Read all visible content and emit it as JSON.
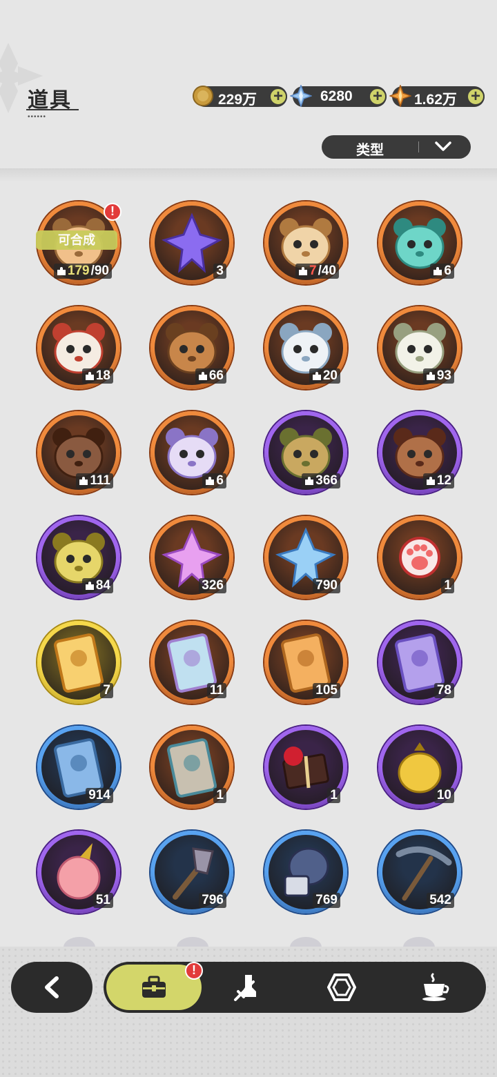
{
  "header": {
    "title": "道具",
    "title_dots": "••••••"
  },
  "currencies": [
    {
      "name": "coin",
      "icon": "gold-coin-icon",
      "value": "229万",
      "color": "#c89a3c"
    },
    {
      "name": "crystal",
      "icon": "crystal-icon",
      "value": "6280",
      "color": "#8fb9e6"
    },
    {
      "name": "star",
      "icon": "star-shard-icon",
      "value": "1.62万",
      "color": "#e0922e"
    }
  ],
  "type_filter": {
    "label": "类型",
    "icon": "chevron-down-icon"
  },
  "items": [
    {
      "id": "puzzle-bear-random",
      "frame": "orange",
      "count": "179",
      "count_max": "/90",
      "puzzle": true,
      "craft_label": "可合成",
      "alert": "!"
    },
    {
      "id": "purple-crystal-shard",
      "frame": "orange",
      "count": "3",
      "puzzle": false
    },
    {
      "id": "mystery-puzzle",
      "frame": "orange",
      "count": "7",
      "count_max": "/40",
      "puzzle": true,
      "low": true
    },
    {
      "id": "teal-chick-puzzle",
      "frame": "orange",
      "count": "6",
      "puzzle": true
    },
    {
      "id": "red-flower-puzzle",
      "frame": "orange",
      "count": "18",
      "puzzle": true
    },
    {
      "id": "brown-bear-puzzle",
      "frame": "orange",
      "count": "66",
      "puzzle": true
    },
    {
      "id": "white-cat-puzzle",
      "frame": "orange",
      "count": "20",
      "puzzle": true
    },
    {
      "id": "white-bunny-puzzle",
      "frame": "orange",
      "count": "93",
      "puzzle": true
    },
    {
      "id": "dark-bear-puzzle",
      "frame": "orange",
      "count": "111",
      "puzzle": true
    },
    {
      "id": "lavender-puzzle",
      "frame": "orange",
      "count": "6",
      "puzzle": true
    },
    {
      "id": "leaf-bear-puzzle",
      "frame": "purple",
      "count": "366",
      "puzzle": true
    },
    {
      "id": "eyepatch-bear-puzzle",
      "frame": "purple",
      "count": "12",
      "puzzle": true
    },
    {
      "id": "yellow-bird-puzzle",
      "frame": "purple",
      "count": "84",
      "puzzle": true
    },
    {
      "id": "pink-star-crystal",
      "frame": "orange",
      "count": "326",
      "puzzle": false
    },
    {
      "id": "blue-star-crystal",
      "frame": "orange",
      "count": "790",
      "puzzle": false
    },
    {
      "id": "paw-charm",
      "frame": "orange",
      "count": "1",
      "puzzle": false
    },
    {
      "id": "gold-card",
      "frame": "gold",
      "count": "7",
      "puzzle": false
    },
    {
      "id": "rainbow-card",
      "frame": "orange",
      "count": "11",
      "puzzle": false
    },
    {
      "id": "orange-card",
      "frame": "orange",
      "count": "105",
      "puzzle": false
    },
    {
      "id": "purple-card",
      "frame": "purple",
      "count": "78",
      "puzzle": false
    },
    {
      "id": "blue-card",
      "frame": "blue",
      "count": "914",
      "puzzle": false
    },
    {
      "id": "spirit-card",
      "frame": "orange",
      "count": "1",
      "puzzle": false
    },
    {
      "id": "gift-box",
      "frame": "purple",
      "count": "1",
      "puzzle": false
    },
    {
      "id": "gold-pouch",
      "frame": "purple",
      "count": "10",
      "puzzle": false
    },
    {
      "id": "pink-apple",
      "frame": "purple",
      "count": "51",
      "puzzle": false
    },
    {
      "id": "shovel",
      "frame": "blue",
      "count": "796",
      "puzzle": false
    },
    {
      "id": "gauntlet",
      "frame": "blue",
      "count": "769",
      "puzzle": false
    },
    {
      "id": "pickaxe",
      "frame": "blue",
      "count": "542",
      "puzzle": false
    }
  ],
  "bottom_nav": {
    "back_icon": "chevron-left-icon",
    "tabs": [
      {
        "name": "items",
        "icon": "briefcase-icon",
        "active": true,
        "alert": "!"
      },
      {
        "name": "equipment",
        "icon": "boot-sword-icon",
        "active": false
      },
      {
        "name": "gems",
        "icon": "hexagon-gem-icon",
        "active": false
      },
      {
        "name": "food",
        "icon": "coffee-cup-icon",
        "active": false
      }
    ]
  },
  "colors": {
    "orange": "#e07a32",
    "purple": "#8a4fd6",
    "blue": "#3e86d8",
    "gold": "#e8c53a",
    "accent": "#d3d66a",
    "dark": "#2b2b2b"
  }
}
